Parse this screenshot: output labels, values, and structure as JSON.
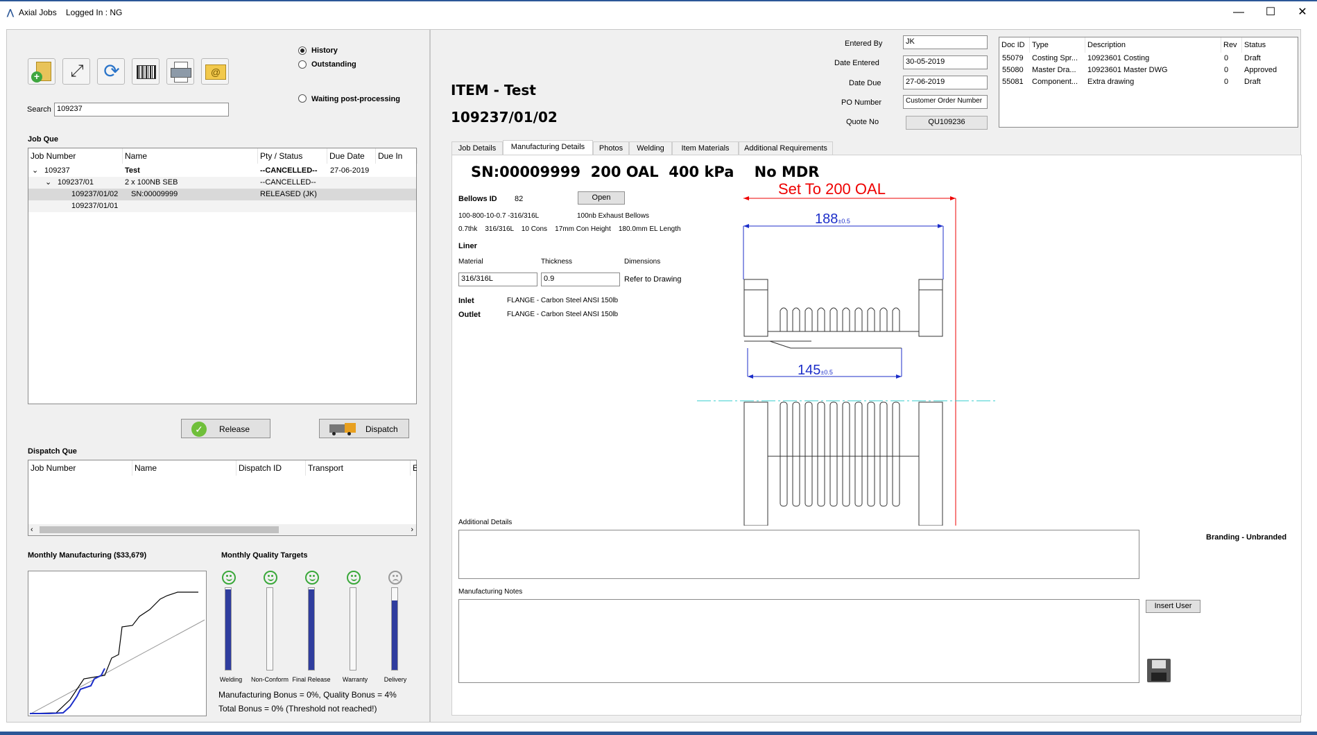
{
  "window": {
    "app_title": "Axial Jobs",
    "logged_in": "Logged In : NG"
  },
  "filters": {
    "history": "History",
    "outstanding": "Outstanding",
    "waiting": "Waiting post-processing"
  },
  "search": {
    "label": "Search",
    "value": "109237"
  },
  "job_que": {
    "title": "Job Que",
    "headers": [
      "Job Number",
      "Name",
      "Pty / Status",
      "Due Date",
      "Due In"
    ],
    "rows": [
      {
        "job": "109237",
        "name": "Test",
        "status": "--CANCELLED--",
        "due": "27-06-2019"
      },
      {
        "job": "109237/01",
        "name": "2 x 100NB SEB",
        "status": "--CANCELLED--",
        "due": ""
      },
      {
        "job": "109237/01/02",
        "name": "SN:00009999",
        "status": "RELEASED (JK)",
        "due": ""
      },
      {
        "job": "109237/01/01",
        "name": "",
        "status": "",
        "due": ""
      }
    ]
  },
  "buttons": {
    "release": "Release",
    "dispatch": "Dispatch",
    "open": "Open",
    "insert_user": "Insert User"
  },
  "dispatch_que": {
    "title": "Dispatch Que",
    "headers": [
      "Job Number",
      "Name",
      "Dispatch ID",
      "Transport",
      "E"
    ]
  },
  "monthly": {
    "manufacturing_title": "Monthly Manufacturing ($33,679)",
    "quality_title": "Monthly Quality Targets"
  },
  "quality_targets": [
    {
      "label": "Welding",
      "level": 0.98,
      "happy": true
    },
    {
      "label": "Non-Conform",
      "level": 0.0,
      "happy": true
    },
    {
      "label": "Final Release",
      "level": 0.98,
      "happy": true
    },
    {
      "label": "Warranty",
      "level": 0.0,
      "happy": true
    },
    {
      "label": "Delivery",
      "level": 0.85,
      "happy": false
    }
  ],
  "bonus": {
    "line1": "Manufacturing Bonus = 0%,  Quality Bonus = 4%",
    "line2": "Total Bonus = 0% (Threshold not reached!)"
  },
  "item": {
    "title": "ITEM - Test",
    "number": "109237/01/02"
  },
  "entry": {
    "entered_by_label": "Entered By",
    "entered_by": "JK",
    "date_entered_label": "Date Entered",
    "date_entered": "30-05-2019",
    "date_due_label": "Date Due",
    "date_due": "27-06-2019",
    "po_label": "PO Number",
    "po": "Customer Order Number",
    "quote_label": "Quote No",
    "quote": "QU109236"
  },
  "docs": {
    "headers": [
      "Doc ID",
      "Type",
      "Description",
      "Rev",
      "Status"
    ],
    "rows": [
      {
        "id": "55079",
        "type": "Costing Spr...",
        "desc": "10923601 Costing",
        "rev": "0",
        "status": "Draft"
      },
      {
        "id": "55080",
        "type": "Master Dra...",
        "desc": "10923601 Master DWG",
        "rev": "0",
        "status": "Approved"
      },
      {
        "id": "55081",
        "type": "Component...",
        "desc": "Extra drawing",
        "rev": "0",
        "status": "Draft"
      }
    ]
  },
  "tabs": [
    "Job Details",
    "Manufacturing Details",
    "Photos",
    "Welding",
    "Item Materials",
    "Additional Requirements"
  ],
  "mfg": {
    "headline": "SN:00009999  200 OAL  400 kPa    No MDR",
    "bellows_label": "Bellows ID",
    "bellows_id": "82",
    "spec_code": "100-800-10-0.7 -316/316L",
    "spec_desc": "100nb Exhaust Bellows",
    "spec_line": "0.7thk    316/316L    10 Cons    17mm Con Height    180.0mm EL Length",
    "liner_label": "Liner",
    "material_label": "Material",
    "material": "316/316L",
    "thickness_label": "Thickness",
    "thickness": "0.9",
    "dimensions_label": "Dimensions",
    "dimensions": "Refer to Drawing",
    "inlet_label": "Inlet",
    "inlet": "FLANGE - Carbon Steel ANSI 150lb",
    "outlet_label": "Outlet",
    "outlet": "FLANGE - Carbon Steel ANSI 150lb",
    "additional_label": "Additional Details",
    "branding": "Branding - Unbranded",
    "notes_label": "Manufacturing Notes"
  },
  "drawing": {
    "set_to": "Set To 200 OAL",
    "dim1": "188",
    "dim1_tol": "±0.5",
    "dim2": "145",
    "dim2_tol": "±0.5"
  }
}
